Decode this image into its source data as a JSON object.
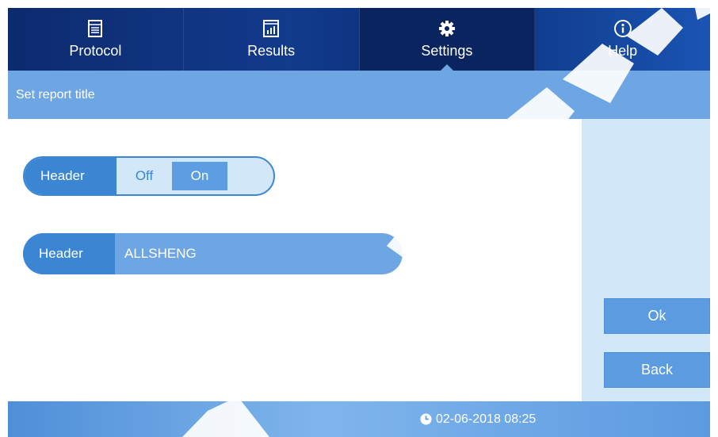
{
  "nav": {
    "tabs": [
      {
        "label": "Protocol",
        "icon": "protocol-icon"
      },
      {
        "label": "Results",
        "icon": "results-chart-icon"
      },
      {
        "label": "Settings",
        "icon": "gear-icon",
        "active": true
      },
      {
        "label": "Help",
        "icon": "info-icon"
      }
    ]
  },
  "page": {
    "title": "Set report title"
  },
  "header_toggle": {
    "label": "Header",
    "off_label": "Off",
    "on_label": "On",
    "selected": "On"
  },
  "header_text": {
    "label": "Header",
    "value": "ALLSHENG"
  },
  "buttons": {
    "ok": "Ok",
    "back": "Back"
  },
  "status": {
    "datetime": "02-06-2018 08:25",
    "icon": "clock-icon"
  },
  "colors": {
    "nav_bg": "#123b8c",
    "accent": "#6ea6e4",
    "panel": "#d2e8f8",
    "pill": "#3a86d2"
  }
}
